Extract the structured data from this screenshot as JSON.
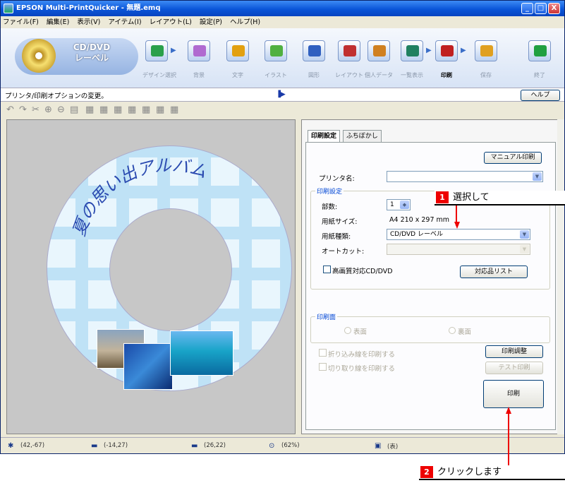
{
  "window": {
    "title": "EPSON Multi-PrintQuicker - 無題.emq",
    "controls": [
      "_",
      "□",
      "X"
    ]
  },
  "menu": [
    "ファイル(F)",
    "編集(E)",
    "表示(V)",
    "アイテム(I)",
    "レイアウト(L)",
    "設定(P)",
    "ヘルプ(H)"
  ],
  "toolbar": {
    "mode_label_1": "CD/DVD",
    "mode_label_2": "レーベル",
    "steps": [
      {
        "label": "デザイン選択",
        "icon": "cd-design-icon",
        "color": "#2aa04a"
      },
      {
        "label": "背景",
        "icon": "brush-icon",
        "color": "#b06ad0"
      },
      {
        "label": "文字",
        "icon": "text-icon",
        "color": "#e2a010"
      },
      {
        "label": "イラスト",
        "icon": "illustration-icon",
        "color": "#50b040"
      },
      {
        "label": "図形",
        "icon": "shape-icon",
        "color": "#3060c0"
      },
      {
        "label": "レイアウト",
        "icon": "layout-icon",
        "color": "#c03030"
      },
      {
        "label": "個人データ",
        "icon": "personal-data-icon",
        "color": "#d08020"
      },
      {
        "label": "一覧表示",
        "icon": "list-view-icon",
        "color": "#208060"
      },
      {
        "label": "印刷",
        "icon": "printer-icon",
        "color": "#c02020"
      },
      {
        "label": "保存",
        "icon": "save-icon",
        "color": "#e0a020"
      },
      {
        "label": "終了",
        "icon": "exit-icon",
        "color": "#20a040"
      }
    ]
  },
  "status": {
    "text": "プリンタ/印刷オプションの変更。",
    "help": "ヘルプ"
  },
  "disc": {
    "title": "夏の思い出アルバム"
  },
  "panel": {
    "tabs": [
      "印刷設定",
      "ふちぼかし"
    ],
    "manual_print": "マニュアル印刷",
    "printer_label": "プリンタ名:",
    "printer_value": "",
    "print_settings_group": "印刷設定",
    "copies_label": "部数:",
    "copies_value": "1",
    "paper_size_label": "用紙サイズ:",
    "paper_size_value": "A4 210 x 297 mm",
    "paper_type_label": "用紙種類:",
    "paper_type_value": "CD/DVD レーベル",
    "autocut_label": "オートカット:",
    "autocut_value": "",
    "hq_checkbox": "高画質対応CD/DVD",
    "compat_list": "対応品リスト",
    "print_side_group": "印刷面",
    "front": "表面",
    "back": "裏面",
    "fold_line": "折り込み線を印刷する",
    "cut_line": "切り取り線を印刷する",
    "print_adjust": "印刷調整",
    "test_print": "テスト印刷",
    "print": "印刷"
  },
  "bottom": {
    "coord1": "(42,-67)",
    "coord2": "(-14,27)",
    "coord3": "(26,22)",
    "zoom": "(62%)",
    "side": "(表)"
  },
  "callouts": [
    {
      "num": "1",
      "text": "選択して"
    },
    {
      "num": "2",
      "text": "クリックします"
    }
  ]
}
